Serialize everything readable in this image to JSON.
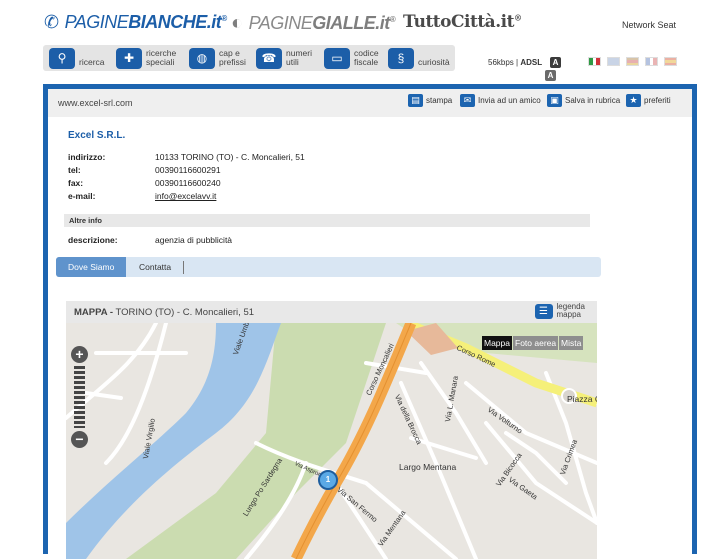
{
  "brands": {
    "pb_a": "PAGINE",
    "pb_b": "BIANCHE",
    "pb_c": ".it",
    "pg_a": "PAGINE",
    "pg_b": "GIALLE",
    "pg_c": ".it",
    "tc": "TuttoCittà",
    "tc_c": ".it",
    "reg": "®"
  },
  "network": "Network Seat",
  "nav": [
    {
      "line1": "ricerca",
      "line2": ""
    },
    {
      "line1": "ricerche",
      "line2": "speciali"
    },
    {
      "line1": "cap e",
      "line2": "prefissi"
    },
    {
      "line1": "numeri",
      "line2": "utili"
    },
    {
      "line1": "codice",
      "line2": "fiscale"
    },
    {
      "line1": "curiosità",
      "line2": ""
    }
  ],
  "speed": {
    "kbps": "56kbps",
    "adsl": "ADSL",
    "a": "A"
  },
  "url": "www.excel-srl.com",
  "tools": {
    "stampa": "stampa",
    "invia": "Invia ad un amico",
    "salva": "Salva in rubrica",
    "preferiti": "preferiti"
  },
  "company": {
    "name": "Excel S.R.L.",
    "fields": [
      {
        "k": "indirizzo:",
        "v": "10133 TORINO (TO) - C. Moncalieri, 51"
      },
      {
        "k": "tel:",
        "v": "00390116600291"
      },
      {
        "k": "fax:",
        "v": "00390116600240"
      },
      {
        "k": "e-mail:",
        "v": "info@excelavv.it"
      }
    ],
    "section": "Altre info",
    "desc_k": "descrizione:",
    "desc_v": "agenzia di pubblicità"
  },
  "tabs": {
    "dove": "Dove Siamo",
    "contatta": "Contatta"
  },
  "map": {
    "title": "MAPPA -",
    "address": "TORINO (TO) - C. Moncalieri, 51",
    "legend1": "legenda",
    "legend2": "mappa",
    "types": [
      "Mappa",
      "Foto aerea",
      "Mista"
    ],
    "marker": "1",
    "labels": {
      "umber": "Viale Umber",
      "virgilio": "Viale Virgilio",
      "sardegna": "Lungo Po Sardegna",
      "moncalieri": "Corso Moncalieri",
      "romo": "Corso Rome",
      "brocca": "Via della Brocca",
      "manara": "Via L. Manara",
      "volturno": "Via Volturno",
      "piazza": "Piazza C",
      "bicocca": "Via Bicocca",
      "gaeta": "Via Gaeta",
      "crimea": "Via Crimea",
      "mentana": "Largo Mentana",
      "sanfermo": "Via San Fermo",
      "viamentana": "Via Mentana",
      "aspromonte": "Via Aspromo"
    }
  },
  "colors": {
    "brand": "#1c64b0",
    "river": "#9fc4e8",
    "park": "#cbdcb0",
    "main_road": "#f3a74a",
    "yellow_road": "#f5f07a"
  }
}
